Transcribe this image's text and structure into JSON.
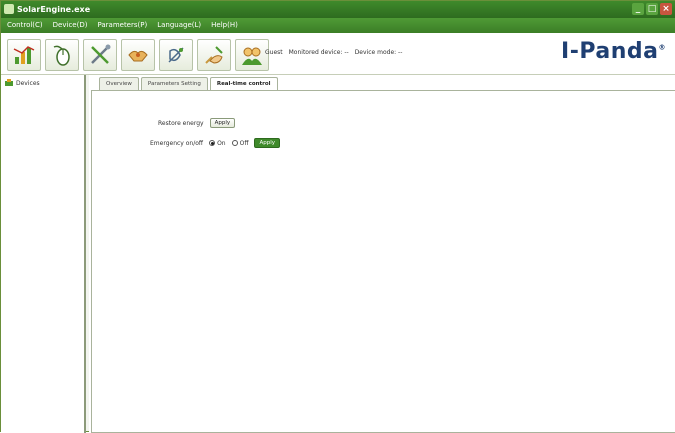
{
  "window": {
    "title": "SolarEngine.exe",
    "min_label": "_",
    "max_label": "□",
    "close_label": "×"
  },
  "menu": {
    "items": [
      "Control(C)",
      "Device(D)",
      "Parameters(P)",
      "Language(L)",
      "Help(H)"
    ]
  },
  "toolbar": {
    "buttons": [
      "chart-icon",
      "mouse-icon",
      "tools-icon",
      "hands-icon",
      "satellite-icon",
      "hand-pen-icon",
      "users-icon"
    ],
    "status_user": "Guest",
    "status_monitored": "Monitored device: --",
    "status_mode": "Device mode: --"
  },
  "logo": {
    "text": "I-Panda",
    "mark": "®"
  },
  "sidebar": {
    "root_label": "Devices"
  },
  "tabs": [
    "Overview",
    "Parameters Setting",
    "Real-time control"
  ],
  "controls": {
    "restore_label": "Restore energy",
    "restore_button": "Apply",
    "emergency_label": "Emergency on/off",
    "on_label": "On",
    "off_label": "Off",
    "emergency_button": "Apply",
    "selected": "On"
  },
  "colors": {
    "accent_green": "#3f8a2b",
    "logo_blue": "#1f3f72"
  }
}
